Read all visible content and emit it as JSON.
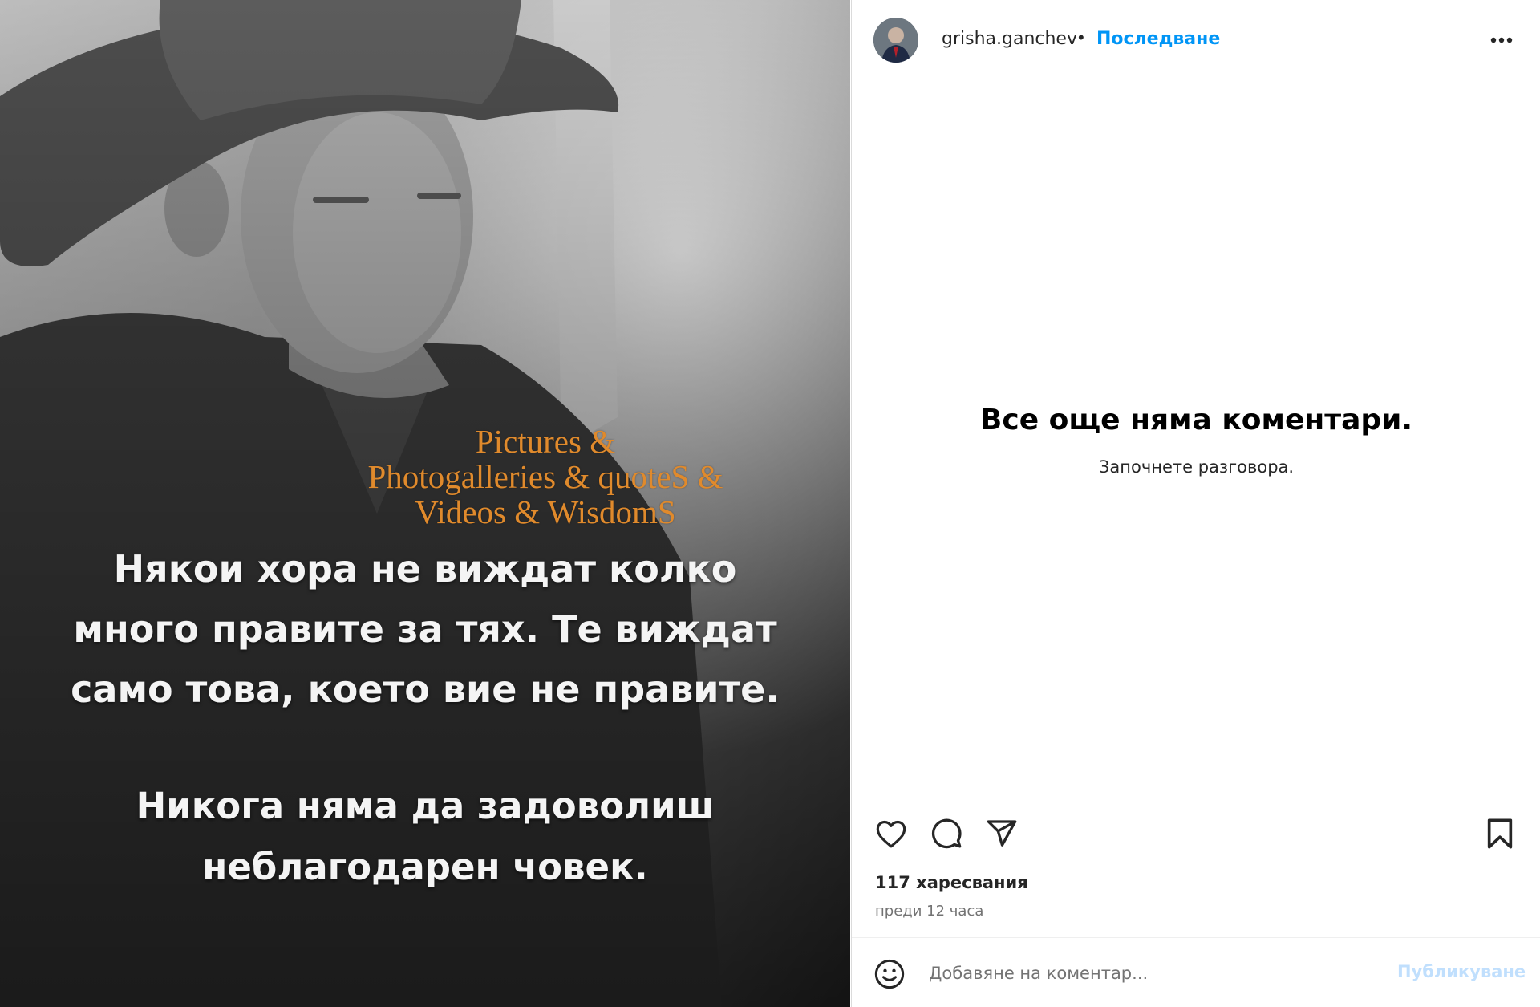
{
  "post": {
    "image": {
      "watermark_lines": [
        "Pictures &",
        "Photogalleries & quoteS &",
        "Videos & WisdomS"
      ],
      "quote_block_1": [
        "Някои хора не виждат колко",
        "много правите за тях. Те виждат",
        "само това, което вие не правите."
      ],
      "quote_block_2": [
        "Никога няма да задоволиш",
        "неблагодарен човек."
      ]
    },
    "header": {
      "username": "grisha.ganchev",
      "separator": "•",
      "follow_label": "Последване",
      "more_icon": "more-horizontal-icon"
    },
    "comments": {
      "empty_title": "Все още няма коментари.",
      "empty_subtitle": "Започнете разговора."
    },
    "actions": {
      "icons": [
        "heart-icon",
        "comment-icon",
        "share-icon",
        "bookmark-icon"
      ],
      "likes_text": "117 харесвания",
      "time_text": "преди 12 часа"
    },
    "comment_box": {
      "emoji_icon": "emoji-icon",
      "placeholder": "Добавяне на коментар...",
      "publish_label": "Публикуване"
    }
  },
  "colors": {
    "accent": "#0095f6",
    "publish_disabled": "#c0dffd",
    "watermark": "#e08a2c",
    "secondary_text": "#737373"
  }
}
